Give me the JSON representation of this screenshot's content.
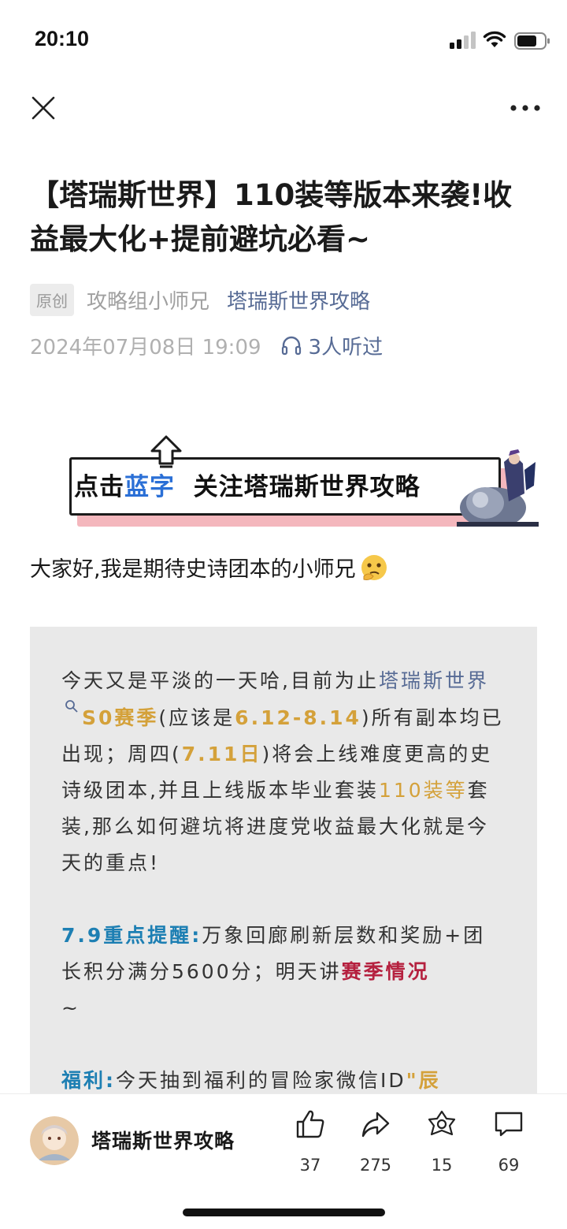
{
  "status_bar": {
    "time": "20:10"
  },
  "article": {
    "title": "【塔瑞斯世界】110装等版本来袭!收益最大化+提前避坑必看~",
    "original_tag": "原创",
    "author": "攻略组小师兄",
    "account": "塔瑞斯世界攻略",
    "publish_date": "2024年07月08日 19:09",
    "listen_count": "3人听过"
  },
  "banner": {
    "part1": "点击",
    "part2": "蓝字",
    "part3": "关注塔瑞斯世界攻略"
  },
  "intro": "大家好,我是期待史诗团本的小师兄",
  "quote": {
    "p1": [
      {
        "text": "今天又是平淡的一天哈,目前为止",
        "style": ""
      },
      {
        "text": "塔瑞斯世界",
        "style": "hl-blue"
      },
      {
        "text": "S0赛季",
        "style": "hl-gold"
      },
      {
        "text": "(应该是",
        "style": ""
      },
      {
        "text": "6.12-8.14",
        "style": "hl-gold"
      },
      {
        "text": ")所有副本均已出现；周四(",
        "style": ""
      },
      {
        "text": "7.11日",
        "style": "hl-gold"
      },
      {
        "text": ")将会上线难度更高的史诗级团本,并且上线版本毕业套装",
        "style": ""
      },
      {
        "text": "110装等",
        "style": "hl-gold-lite"
      },
      {
        "text": "套装,那么如何避坑将进度党收益最大化就是今天的重点!",
        "style": ""
      }
    ],
    "p2": [
      {
        "text": "7.9重点提醒:",
        "style": "hl-teal"
      },
      {
        "text": "万象回廊刷新层数和奖励+团长积分满分5600分；明天讲",
        "style": ""
      },
      {
        "text": "赛季情况",
        "style": "hl-red"
      },
      {
        "text": "~",
        "style": ""
      }
    ],
    "p3": [
      {
        "text": "福利:",
        "style": "hl-teal"
      },
      {
        "text": "今天抽到福利的冒险家微信ID",
        "style": ""
      },
      {
        "text": "\"辰",
        "style": "hl-gold"
      }
    ]
  },
  "bottom_bar": {
    "account_name": "塔瑞斯世界攻略",
    "like_count": "37",
    "share_count": "275",
    "favorite_count": "15",
    "comment_count": "69"
  },
  "colors": {
    "link_blue": "#576b95",
    "gold": "#d4a13a",
    "teal": "#1d7fb3",
    "red": "#b5213f",
    "quote_bg": "#e9e9e9"
  }
}
